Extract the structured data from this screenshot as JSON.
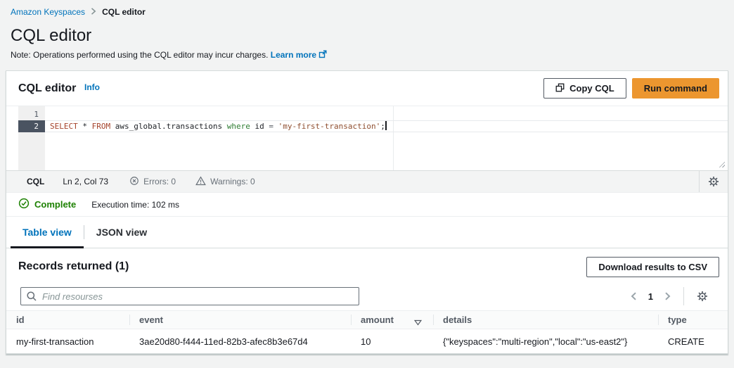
{
  "breadcrumb": {
    "root": "Amazon Keyspaces",
    "current": "CQL editor"
  },
  "page": {
    "title": "CQL editor",
    "note": "Note: Operations performed using the CQL editor may incur charges.",
    "learn_more_label": "Learn more"
  },
  "editor_panel": {
    "title": "CQL editor",
    "info_label": "Info",
    "copy_button_label": "Copy CQL",
    "run_button_label": "Run command",
    "code": {
      "lines": [
        {
          "number": "1",
          "text": ""
        },
        {
          "number": "2",
          "active": true,
          "tokens": [
            {
              "text": "SELECT",
              "style": "keyword"
            },
            {
              "text": " * ",
              "style": "plain"
            },
            {
              "text": "FROM",
              "style": "keyword"
            },
            {
              "text": " aws_global.transactions ",
              "style": "plain"
            },
            {
              "text": "where",
              "style": "builtin"
            },
            {
              "text": " id ",
              "style": "plain"
            },
            {
              "text": "= ",
              "style": "operator"
            },
            {
              "text": "'my-first-transaction'",
              "style": "string"
            },
            {
              "text": ";",
              "style": "plain"
            }
          ]
        }
      ]
    },
    "status_bar": {
      "language": "CQL",
      "cursor_position": "Ln 2, Col 73",
      "errors": "Errors: 0",
      "warnings": "Warnings: 0"
    },
    "execution_status": {
      "state": "Complete",
      "detail": "Execution time: 102 ms"
    }
  },
  "tabs": [
    {
      "label": "Table view",
      "active": true
    },
    {
      "label": "JSON view",
      "active": false
    }
  ],
  "results": {
    "title": "Records returned (1)",
    "download_button_label": "Download results to CSV",
    "search_placeholder": "Find resourses",
    "pagination": {
      "current_page": "1"
    },
    "table": {
      "columns": [
        {
          "label": "id"
        },
        {
          "label": "event"
        },
        {
          "label": "amount",
          "sorted": "descending"
        },
        {
          "label": "details"
        },
        {
          "label": "type"
        }
      ],
      "rows": [
        {
          "id": "my-first-transaction",
          "event": "3ae20d80-f444-11ed-82b3-afec8b3e67d4",
          "amount": "10",
          "details": "{\"keyspaces\":\"multi-region\",\"local\":\"us-east2\"}",
          "type": "CREATE"
        }
      ]
    }
  },
  "colors": {
    "run_button_orange": "#ec962f",
    "link_blue": "#0073bb",
    "success_green": "#1d8102",
    "keyword_red": "#a5432c",
    "string_brown": "#8f4e2f",
    "builtin_green": "#2e7d32",
    "active_gutter_slate": "#4a5361",
    "page_background": "#f2f3f3"
  }
}
